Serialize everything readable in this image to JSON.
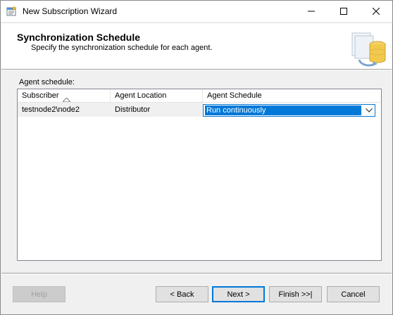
{
  "window": {
    "title": "New Subscription Wizard",
    "icons": {
      "app": "wizard-window-icon",
      "minimize": "minimize-icon",
      "maximize": "maximize-icon",
      "close": "close-icon"
    }
  },
  "header": {
    "title": "Synchronization Schedule",
    "subtitle": "Specify the synchronization schedule for each agent.",
    "art_icon": "database-sync-icon"
  },
  "agent_schedule": {
    "label": "Agent schedule:",
    "columns": [
      "Subscriber",
      "Agent Location",
      "Agent Schedule"
    ],
    "sort_icon": "sort-ascending-icon",
    "rows": [
      {
        "subscriber": "testnode2\\node2",
        "location": "Distributor",
        "schedule": "Run continuously"
      }
    ],
    "dropdown_icon": "chevron-down-icon"
  },
  "buttons": {
    "help": "Help",
    "back": "< Back",
    "next": "Next >",
    "finish": "Finish >>|",
    "cancel": "Cancel"
  },
  "colors": {
    "accent": "#0078d7",
    "background": "#f0f0f0",
    "header_bg": "#ffffff"
  }
}
